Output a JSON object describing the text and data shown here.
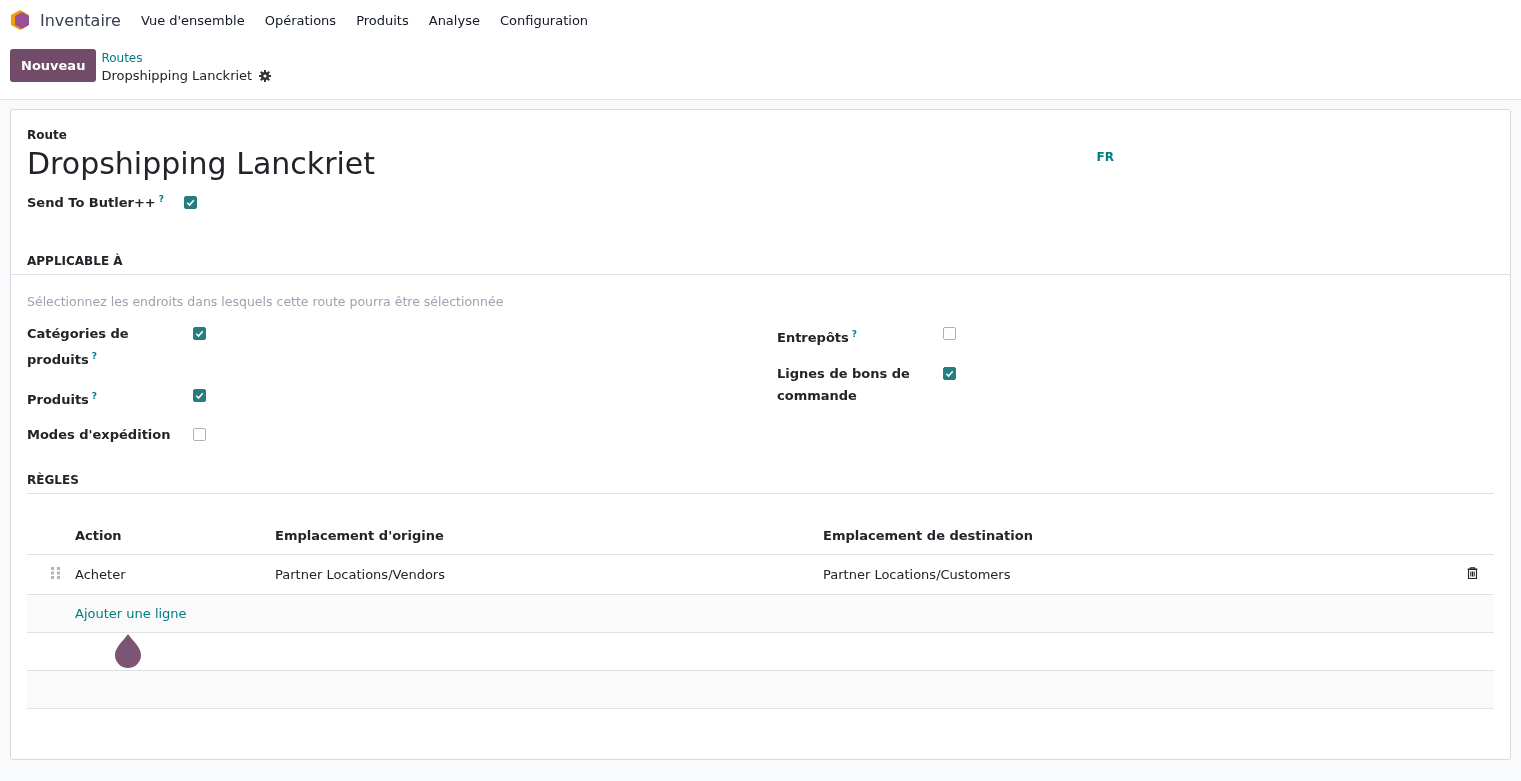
{
  "navbar": {
    "app_name": "Inventaire",
    "menu": [
      "Vue d'ensemble",
      "Opérations",
      "Produits",
      "Analyse",
      "Configuration"
    ]
  },
  "control_panel": {
    "new_button": "Nouveau",
    "breadcrumb": "Routes",
    "record_title": "Dropshipping Lanckriet"
  },
  "form": {
    "name_label": "Route",
    "name": "Dropshipping Lanckriet",
    "language": "FR",
    "send_field": {
      "label": "Send To Butler++",
      "hint": "?",
      "checked": true
    },
    "applicable": {
      "title": "APPLICABLE À",
      "description": "Sélectionnez les endroits dans lesquels cette route pourra être sélectionnée",
      "left": [
        {
          "label": "Catégories de produits",
          "hint": "?",
          "checked": true
        },
        {
          "label": "Produits",
          "hint": "?",
          "checked": true
        },
        {
          "label": "Modes d'expédition",
          "checked": false
        }
      ],
      "right": [
        {
          "label": "Entrepôts",
          "hint": "?",
          "checked": false
        },
        {
          "label": "Lignes de bons de commande",
          "checked": true
        }
      ]
    },
    "rules": {
      "title": "RÈGLES",
      "columns": [
        "Action",
        "Emplacement d'origine",
        "Emplacement de destination"
      ],
      "rows": [
        [
          "Acheter",
          "Partner Locations/Vendors",
          "Partner Locations/Customers"
        ]
      ],
      "add_line": "Ajouter une ligne"
    }
  }
}
